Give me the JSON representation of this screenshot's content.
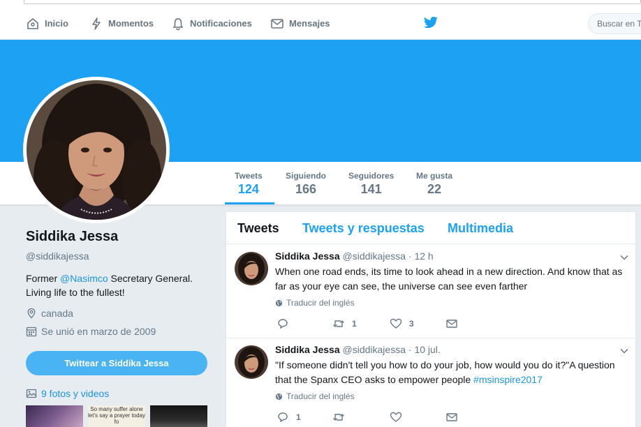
{
  "nav": {
    "home": "Inicio",
    "moments": "Momentos",
    "notifications": "Notificaciones",
    "messages": "Mensajes",
    "search_placeholder": "Buscar en T"
  },
  "colors": {
    "accent": "#1da1f2",
    "banner": "#1da1f2",
    "button": "#4ab3f4",
    "link": "#1b95e0"
  },
  "stats": [
    {
      "label": "Tweets",
      "value": "124"
    },
    {
      "label": "Siguiendo",
      "value": "166"
    },
    {
      "label": "Seguidores",
      "value": "141"
    },
    {
      "label": "Me gusta",
      "value": "22"
    }
  ],
  "profile": {
    "name": "Siddika Jessa",
    "handle": "@siddikajessa",
    "bio_pre": "Former ",
    "bio_mention": "@Nasimco",
    "bio_post": " Secretary General. Living life to the fullest!",
    "location": "canada",
    "joined": "Se unió en marzo de 2009",
    "tweet_button": "Twittear a Siddika Jessa",
    "photos_link": "9 fotos y videos",
    "thumb_text": "So many suffer alone let's say a prayer today fo"
  },
  "timeline": {
    "tabs": [
      "Tweets",
      "Tweets y respuestas",
      "Multimedia"
    ],
    "tweets": [
      {
        "name": "Siddika Jessa",
        "handle": "@siddikajessa",
        "time": "· 12 h",
        "text_pre": "When one road ends, its time to look ahead in a new direction. And know that as far as your eye can see, the universe can see even farther",
        "hashtag": "",
        "translate": "Traducir del inglés",
        "replies": "",
        "retweets": "1",
        "likes": "3"
      },
      {
        "name": "Siddika Jessa",
        "handle": "@siddikajessa",
        "time": "· 10 jul.",
        "text_pre": "\"If someone didn't tell you how to do your job, how would you do it?\"A question that the Spanx CEO asks to empower people ",
        "hashtag": "#msinspire2017",
        "translate": "Traducir del inglés",
        "replies": "1",
        "retweets": "",
        "likes": ""
      }
    ]
  }
}
